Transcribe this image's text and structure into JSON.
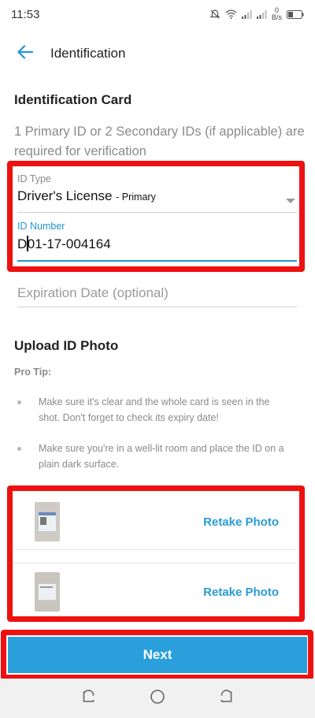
{
  "status_bar": {
    "time": "11:53",
    "net_speed_value": "0",
    "net_speed_unit": "B/s"
  },
  "app_bar": {
    "title": "Identification",
    "back_icon": "arrow-left-icon"
  },
  "card_section": {
    "title": "Identification Card",
    "subtitle": "1 Primary ID or 2 Secondary IDs (if applicable) are required for verification"
  },
  "id_type": {
    "label": "ID Type",
    "value": "Driver's License",
    "qualifier": "- Primary"
  },
  "id_number": {
    "label": "ID Number",
    "value_after_caret": "01-17-004164",
    "value_before_caret": "D"
  },
  "expiration": {
    "placeholder": "Expiration Date (optional)"
  },
  "upload_section": {
    "title": "Upload ID Photo",
    "protip_label": "Pro Tip:",
    "tips": [
      "Make sure it's clear and the whole card is seen in the shot. Don't forget to check its expiry date!",
      "Make sure you're in a well-lit room and place the ID on a plain dark surface."
    ]
  },
  "photos": [
    {
      "action": "Retake Photo"
    },
    {
      "action": "Retake Photo"
    }
  ],
  "next_button": {
    "label": "Next"
  },
  "colors": {
    "accent": "#2196d3",
    "button": "#2a9fdc",
    "highlight": "#ee1111",
    "muted": "#8a8a8a"
  }
}
